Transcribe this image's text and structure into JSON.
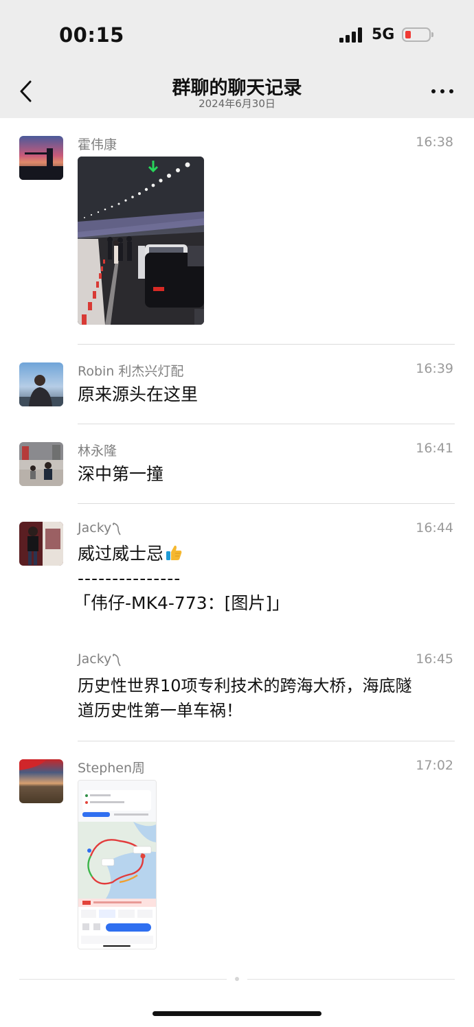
{
  "status_bar": {
    "time": "00:15",
    "network": "5G",
    "battery_level": 0.15
  },
  "nav": {
    "title": "群聊的聊天记录",
    "subtitle": "2024年6月30日"
  },
  "messages": [
    {
      "sender": "霍伟康",
      "time": "16:38",
      "type": "image",
      "image": "tunnel-accident-photo"
    },
    {
      "sender": "Robin 利杰兴灯配",
      "time": "16:39",
      "text": "原来源头在这里"
    },
    {
      "sender": "林永隆",
      "time": "16:41",
      "text": "深中第一撞"
    },
    {
      "sender": "Jacky",
      "time": "16:44",
      "line1": "威过威士忌",
      "line2": "---------------",
      "line3": "「伟仔-MK4-773：[图片]」",
      "emoji": "thumbs-up-icon"
    },
    {
      "sender": "Jacky",
      "time": "16:45",
      "line1": "历史性世界10项专利技术的跨海大桥，海底隧",
      "line2": "道历史性第一单车祸！"
    },
    {
      "sender": "Stephen周",
      "time": "17:02",
      "type": "image",
      "image": "map-route-screenshot"
    }
  ],
  "colors": {
    "nav_bg": "#ededed",
    "battery_red": "#f03a34",
    "sender_gray": "#808080"
  }
}
